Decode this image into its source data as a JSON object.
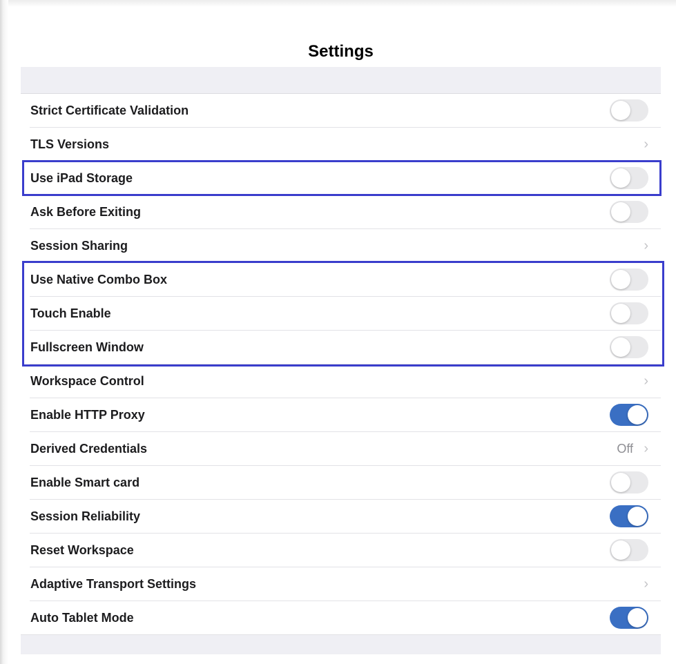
{
  "header": {
    "title": "Settings"
  },
  "colors": {
    "toggle_on": "#3a6fc3",
    "toggle_off": "#e9e9eb",
    "highlight": "#3a3dcc"
  },
  "settings": [
    {
      "label": "Strict Certificate Validation",
      "control": "toggle",
      "on": false
    },
    {
      "label": "TLS Versions",
      "control": "chevron"
    },
    {
      "label": "Use iPad Storage",
      "control": "toggle",
      "on": false
    },
    {
      "label": "Ask Before Exiting",
      "control": "toggle",
      "on": false
    },
    {
      "label": "Session Sharing",
      "control": "chevron"
    },
    {
      "label": "Use Native Combo Box",
      "control": "toggle",
      "on": false
    },
    {
      "label": "Touch Enable",
      "control": "toggle",
      "on": false
    },
    {
      "label": "Fullscreen Window",
      "control": "toggle",
      "on": false
    },
    {
      "label": "Workspace Control",
      "control": "chevron"
    },
    {
      "label": "Enable HTTP Proxy",
      "control": "toggle",
      "on": true
    },
    {
      "label": "Derived Credentials",
      "control": "chevron",
      "value": "Off"
    },
    {
      "label": "Enable Smart card",
      "control": "toggle",
      "on": false
    },
    {
      "label": "Session Reliability",
      "control": "toggle",
      "on": true
    },
    {
      "label": "Reset Workspace",
      "control": "toggle",
      "on": false
    },
    {
      "label": "Adaptive Transport Settings",
      "control": "chevron"
    },
    {
      "label": "Auto Tablet Mode",
      "control": "toggle",
      "on": true
    }
  ],
  "icons": {
    "chevron": "chevron-right-icon"
  }
}
